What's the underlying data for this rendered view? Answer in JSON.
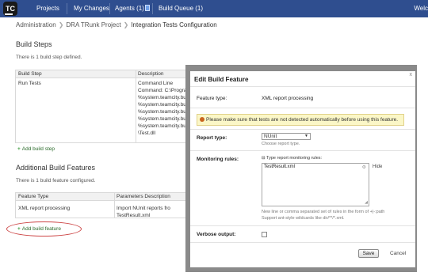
{
  "app": {
    "logo_text": "TC",
    "nav": {
      "projects": "Projects",
      "my_changes": "My Changes",
      "agents": "Agents (1)",
      "build_queue": "Build Queue (1)"
    },
    "user_fragment": "Welc"
  },
  "breadcrumb": [
    "Administration",
    "DRA TRunk Project",
    "Integration Tests Configuration"
  ],
  "build_steps": {
    "title": "Build Steps",
    "note": "There is 1 build step defined.",
    "columns": [
      "Build Step",
      "Description"
    ],
    "row": {
      "name": "Run Tests",
      "description": [
        "Command Line",
        "Command: C:\\Progra",
        "%system.teamcity.build",
        "%system.teamcity.build",
        "%system.teamcity.build",
        "%system.teamcity.build",
        "%system.teamcity.build",
        "\\Test.dll"
      ]
    },
    "add_link": "Add build step"
  },
  "additional_features": {
    "title": "Additional Build Features",
    "note": "There is 1 build feature configured.",
    "columns": [
      "Feature Type",
      "Parameters Description"
    ],
    "row": {
      "type": "XML report processing",
      "params": [
        "Import NUnit reports fro",
        "TestResult.xml"
      ]
    },
    "add_link": "Add build feature"
  },
  "dialog": {
    "title": "Edit Build Feature",
    "close": "x",
    "feature_type_label": "Feature type:",
    "feature_type_value": "XML report processing",
    "warning": "Please make sure that tests are not detected automatically before using this feature.",
    "report_type_label": "Report type:",
    "report_type_value": "NUnit",
    "report_type_hint": "Choose report type.",
    "monitoring_label": "Monitoring rules:",
    "monitoring_header": "Type report monitoring rules:",
    "monitoring_value": "TestResult.xml",
    "hide_link": "Hide",
    "hint_line1": "New line or comma separated set of rules in the form of +|-:path",
    "hint_line2": "Support ant-style wildcards like dir/**/*.xml.",
    "verbose_label": "Verbose output:",
    "save": "Save",
    "cancel": "Cancel"
  },
  "colors": {
    "topbar": "#2f4e8f",
    "accent": "#3c9a3c",
    "warning_bg": "#fbf7c7",
    "highlight_circle": "#cc4444"
  }
}
